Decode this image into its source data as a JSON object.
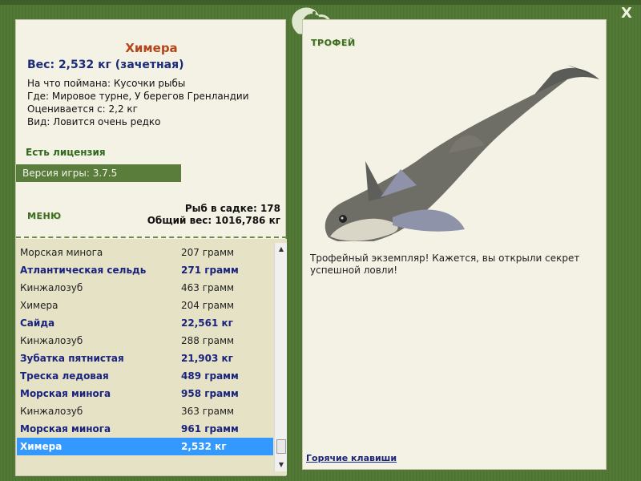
{
  "window": {
    "close_label": "X"
  },
  "fish": {
    "name": "Химера",
    "weight_line": "Вес: 2,532 кг (зачетная)",
    "info": [
      "На что поймана: Кусочки рыбы",
      "Где: Мировое турне, У берегов Гренландии",
      "Оценивается с: 2,2 кг",
      "Вид: Ловится очень редко"
    ]
  },
  "license_text": "Есть лицензия",
  "version_text": "Версия игры: 3.7.5",
  "menu_label": "МЕНЮ",
  "stats": {
    "fish_count": "Рыб в садке: 178",
    "total_weight": "Общий вес: 1016,786 кг"
  },
  "catch_list": [
    {
      "name": "Морская минога",
      "weight": "207 грамм",
      "style": "normal"
    },
    {
      "name": "Атлантическая сельдь",
      "weight": "271 грамм",
      "style": "bold"
    },
    {
      "name": "Кинжалозуб",
      "weight": "463 грамм",
      "style": "normal"
    },
    {
      "name": "Химера",
      "weight": "204 грамм",
      "style": "normal"
    },
    {
      "name": "Сайда",
      "weight": "22,561 кг",
      "style": "bold"
    },
    {
      "name": "Кинжалозуб",
      "weight": "288 грамм",
      "style": "normal"
    },
    {
      "name": "Зубатка пятнистая",
      "weight": "21,903 кг",
      "style": "bold"
    },
    {
      "name": "Треска ледовая",
      "weight": "489 грамм",
      "style": "bold"
    },
    {
      "name": "Морская минога",
      "weight": "958 грамм",
      "style": "bold"
    },
    {
      "name": "Кинжалозуб",
      "weight": "363 грамм",
      "style": "normal"
    },
    {
      "name": "Морская минога",
      "weight": "961 грамм",
      "style": "bold"
    },
    {
      "name": "Химера",
      "weight": "2,532 кг",
      "style": "selected"
    }
  ],
  "trophy": {
    "title": "ТРОФЕЙ",
    "text": "Трофейный экземпляр! Кажется, вы открыли секрет успешной ловли!"
  },
  "hotkeys_label": "Горячие клавиши",
  "icons": {
    "scroll_up": "▲",
    "scroll_down": "▼"
  },
  "colors": {
    "frame_green": "#4f7434",
    "panel_bg": "#f4f1e5",
    "fish_name": "#b4461c",
    "highlight_blue": "#1a237e",
    "selection": "#3399ff"
  }
}
